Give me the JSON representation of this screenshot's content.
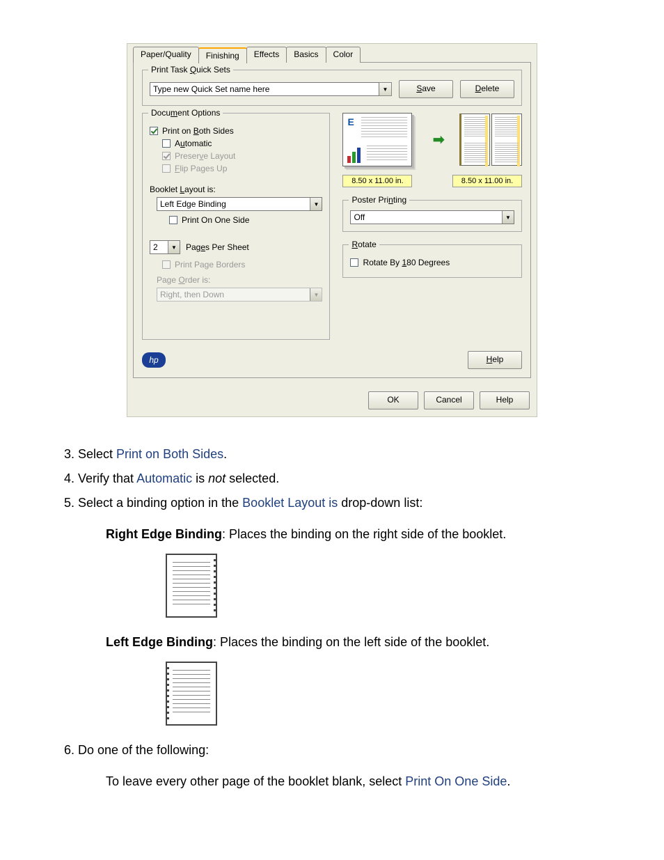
{
  "dialog": {
    "tabs": [
      "Paper/Quality",
      "Finishing",
      "Effects",
      "Basics",
      "Color"
    ],
    "active_tab": "Finishing",
    "quick_sets": {
      "title": "Print Task Quick Sets",
      "placeholder": "Type new Quick Set name here",
      "save": "Save",
      "delete": "Delete"
    },
    "doc_options": {
      "title": "Document Options",
      "print_both_sides": "Print on Both Sides",
      "automatic": "Automatic",
      "preserve_layout": "Preserve Layout",
      "flip_pages_up": "Flip Pages Up",
      "booklet_layout_is": "Booklet Layout is:",
      "booklet_value": "Left Edge Binding",
      "print_one_side": "Print On One Side",
      "pages_per_sheet_value": "2",
      "pages_per_sheet_label": "Pages Per Sheet",
      "print_page_borders": "Print Page Borders",
      "page_order_is": "Page Order is:",
      "page_order_value": "Right, then Down"
    },
    "preview": {
      "size1": "8.50 x 11.00 in.",
      "size2": "8.50 x 11.00 in."
    },
    "poster": {
      "title": "Poster Printing",
      "value": "Off"
    },
    "rotate": {
      "title": "Rotate",
      "rotate_180": "Rotate By 180 Degrees"
    },
    "help": "Help",
    "buttons": {
      "ok": "OK",
      "cancel": "Cancel",
      "help": "Help"
    }
  },
  "doc": {
    "step3_a": "Select ",
    "step3_b": "Print on Both Sides",
    "step3_c": ".",
    "step4_a": "Verify that ",
    "step4_b": "Automatic",
    "step4_c": " is ",
    "step4_d": "not",
    "step4_e": " selected.",
    "step5_a": "Select a binding option in the ",
    "step5_b": "Booklet Layout is",
    "step5_c": " drop-down list:",
    "right_b": "Right Edge Binding",
    "right_t": ": Places the binding on the right side of the booklet.",
    "left_b": "Left Edge Binding",
    "left_t": ": Places the binding on the left side of the booklet.",
    "step6": "Do one of the following:",
    "step6_sub_a": "To leave every other page of the booklet blank, select ",
    "step6_sub_b": "Print On One Side",
    "step6_sub_c": "."
  }
}
